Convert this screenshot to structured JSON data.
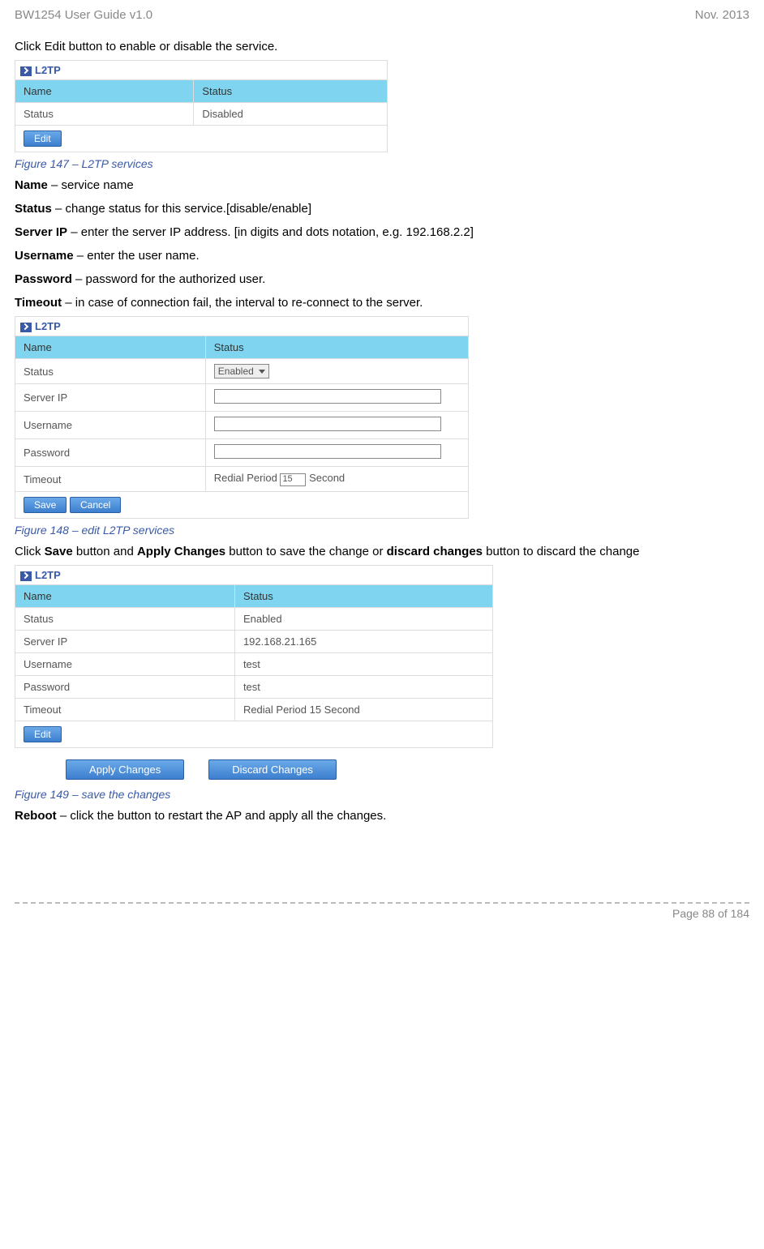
{
  "header": {
    "left": "BW1254 User Guide v1.0",
    "right": "Nov.  2013"
  },
  "intro_para": "Click Edit button to enable or disable the service.",
  "fig147": {
    "title": "L2TP",
    "header_name": "Name",
    "header_status": "Status",
    "row_name": "Status",
    "row_value": "Disabled",
    "edit_btn": "Edit",
    "caption": "Figure 147 – L2TP services"
  },
  "defs": {
    "name_label": "Name",
    "name_desc": " – service name",
    "status_label": "Status",
    "status_desc": " – change status for this service.[disable/enable]",
    "serverip_label": "Server IP",
    "serverip_desc": " – enter the server IP address. [in digits and dots notation, e.g. 192.168.2.2]",
    "username_label": "Username",
    "username_desc": " – enter the user name.",
    "password_label": "Password",
    "password_desc": " – password for the authorized user.",
    "timeout_label": "Timeout",
    "timeout_desc": " – in case of connection fail, the interval to re-connect to the server."
  },
  "fig148": {
    "title": "L2TP",
    "header_name": "Name",
    "header_status": "Status",
    "rows": {
      "status": "Status",
      "status_val": "Enabled",
      "serverip": "Server IP",
      "username": "Username",
      "password": "Password",
      "timeout": "Timeout",
      "timeout_prefix": "Redial Period",
      "timeout_value": "15",
      "timeout_suffix": "Second"
    },
    "save_btn": "Save",
    "cancel_btn": "Cancel",
    "caption": "Figure 148 – edit L2TP services"
  },
  "save_para": {
    "p1": "Click ",
    "p2": "Save",
    "p3": " button and ",
    "p4": "Apply Changes",
    "p5": " button to save the change or ",
    "p6": "discard changes",
    "p7": " button to discard the change"
  },
  "fig149": {
    "title": "L2TP",
    "header_name": "Name",
    "header_status": "Status",
    "rows": {
      "status": "Status",
      "status_val": "Enabled",
      "serverip": "Server IP",
      "serverip_val": "192.168.21.165",
      "username": "Username",
      "username_val": "test",
      "password": "Password",
      "password_val": "test",
      "timeout": "Timeout",
      "timeout_val": "Redial Period 15 Second"
    },
    "edit_btn": "Edit",
    "apply_btn": "Apply Changes",
    "discard_btn": "Discard Changes",
    "caption": "Figure 149 – save the changes"
  },
  "reboot": {
    "label": "Reboot",
    "desc": " – click the button to restart the AP and apply all the changes."
  },
  "footer": {
    "page": "Page 88 of 184"
  }
}
